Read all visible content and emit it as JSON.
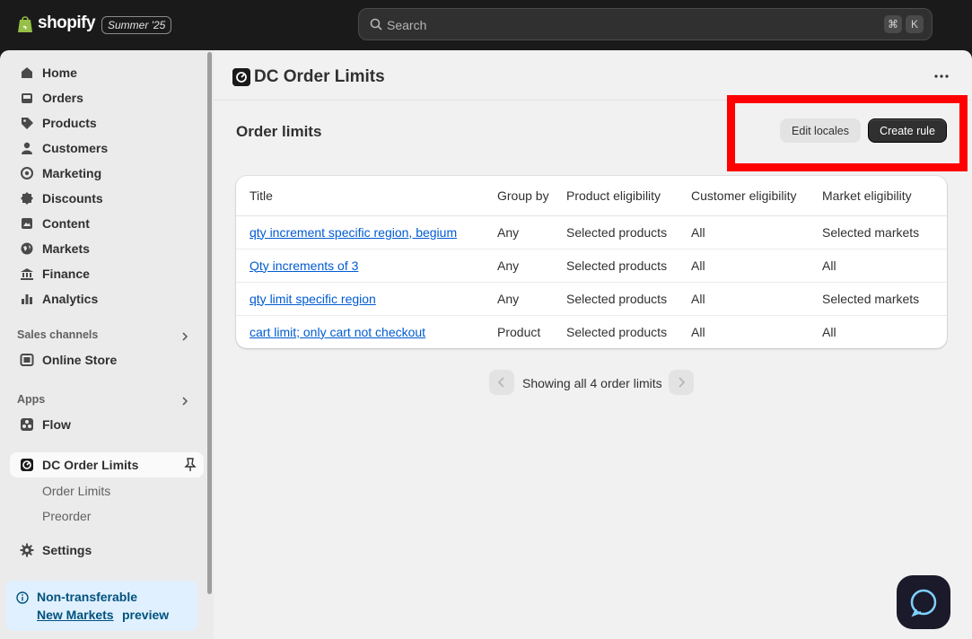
{
  "topbar": {
    "brand": "shopify",
    "edition": "Summer '25",
    "search_placeholder": "Search",
    "shortcut_keys": [
      "⌘",
      "K"
    ]
  },
  "sidebar": {
    "nav": [
      {
        "label": "Home",
        "icon": "home-icon"
      },
      {
        "label": "Orders",
        "icon": "inbox-icon"
      },
      {
        "label": "Products",
        "icon": "tag-icon"
      },
      {
        "label": "Customers",
        "icon": "person-icon"
      },
      {
        "label": "Marketing",
        "icon": "target-icon"
      },
      {
        "label": "Discounts",
        "icon": "discount-icon"
      },
      {
        "label": "Content",
        "icon": "content-icon"
      },
      {
        "label": "Markets",
        "icon": "globe-icon"
      },
      {
        "label": "Finance",
        "icon": "bank-icon"
      },
      {
        "label": "Analytics",
        "icon": "bar-chart-icon"
      }
    ],
    "sales_channels_label": "Sales channels",
    "online_store_label": "Online Store",
    "apps_label": "Apps",
    "flow_label": "Flow",
    "app_label": "DC Order Limits",
    "app_subitems": [
      "Order Limits",
      "Preorder"
    ],
    "settings_label": "Settings",
    "notice": {
      "line1": "Non-transferable",
      "line2": "New Markets",
      "line3": "preview"
    }
  },
  "main": {
    "app_title": "DC Order Limits",
    "page_title": "Order limits",
    "edit_locales_label": "Edit locales",
    "create_rule_label": "Create rule",
    "table": {
      "headers": [
        "Title",
        "Group by",
        "Product eligibility",
        "Customer eligibility",
        "Market eligibility"
      ],
      "rows": [
        [
          "qty increment specific region, begium",
          "Any",
          "Selected products",
          "All",
          "Selected markets"
        ],
        [
          "Qty increments of 3",
          "Any",
          "Selected products",
          "All",
          "All"
        ],
        [
          "qty limit specific region",
          "Any",
          "Selected products",
          "All",
          "Selected markets"
        ],
        [
          "cart limit; only cart not checkout",
          "Product",
          "Selected products",
          "All",
          "All"
        ]
      ]
    },
    "pagination_text": "Showing all 4 order limits"
  },
  "colors": {
    "accent": "#303030",
    "link": "#005bd3",
    "highlight": "#ff0000"
  }
}
